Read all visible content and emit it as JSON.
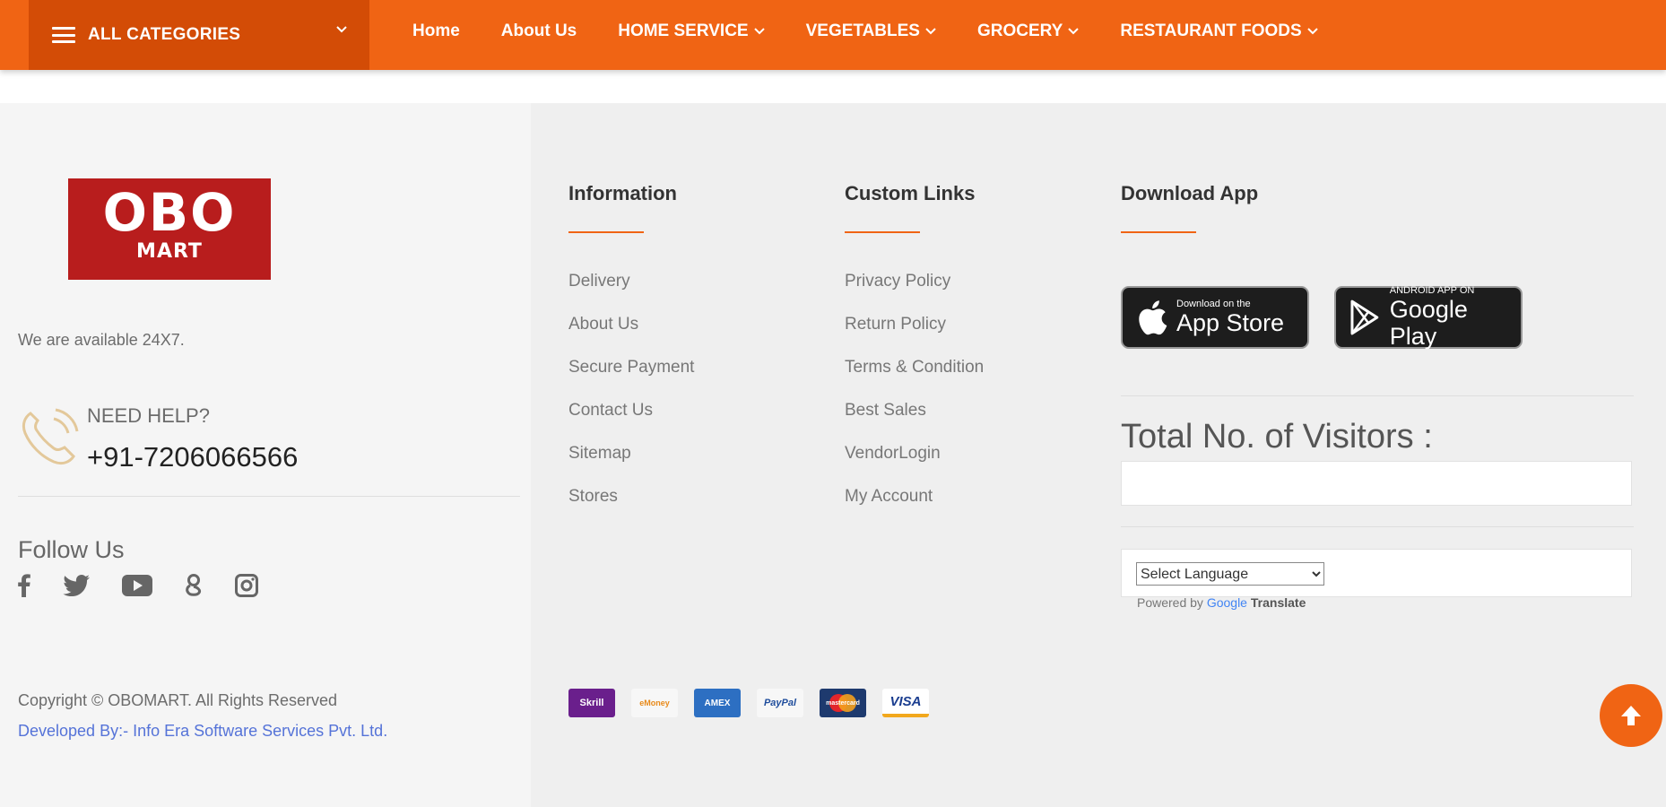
{
  "nav": {
    "all_categories": "ALL CATEGORIES",
    "items": [
      {
        "label": "Home",
        "has_dropdown": false
      },
      {
        "label": "About Us",
        "has_dropdown": false
      },
      {
        "label": "HOME SERVICE",
        "has_dropdown": true
      },
      {
        "label": "VEGETABLES",
        "has_dropdown": true
      },
      {
        "label": "GROCERY",
        "has_dropdown": true
      },
      {
        "label": "RESTAURANT FOODS",
        "has_dropdown": true
      }
    ]
  },
  "brand": {
    "logo_top": "OBO",
    "logo_bottom": "MART"
  },
  "contact": {
    "availability": "We are available 24X7.",
    "need_help": "NEED HELP?",
    "phone": "+91-7206066566"
  },
  "follow": {
    "title": "Follow Us",
    "icons": [
      "facebook-icon",
      "twitter-icon",
      "youtube-icon",
      "google-plus-icon",
      "instagram-icon"
    ]
  },
  "footer": {
    "copyright": "Copyright © OBOMART. All Rights Reserved",
    "developed_by": "Developed By:- Info Era Software Services Pvt. Ltd."
  },
  "columns": {
    "information": {
      "title": "Information",
      "links": [
        "Delivery",
        "About Us",
        "Secure Payment",
        "Contact Us",
        "Sitemap",
        "Stores"
      ]
    },
    "custom_links": {
      "title": "Custom Links",
      "links": [
        "Privacy Policy",
        "Return Policy",
        "Terms & Condition",
        "Best Sales",
        "VendorLogin",
        "My Account"
      ]
    },
    "download": {
      "title": "Download App"
    }
  },
  "apps": {
    "appstore": {
      "small": "Download on the",
      "big": "App Store"
    },
    "googleplay": {
      "small": "ANDROID APP ON",
      "big": "Google Play"
    }
  },
  "visitors": {
    "label": "Total No. of Visitors :"
  },
  "language": {
    "selected": "Select Language",
    "powered_prefix": "Powered by",
    "google": "Google",
    "translate": "Translate"
  },
  "payments": {
    "labels": [
      "Skrill",
      "eMoney",
      "AMEX",
      "PayPal",
      "mastercard",
      "VISA"
    ]
  },
  "colors": {
    "brand_orange": "#f06414",
    "dark_orange": "#d34c06",
    "logo_red": "#b81d1d",
    "link_blue": "#5573d8"
  }
}
